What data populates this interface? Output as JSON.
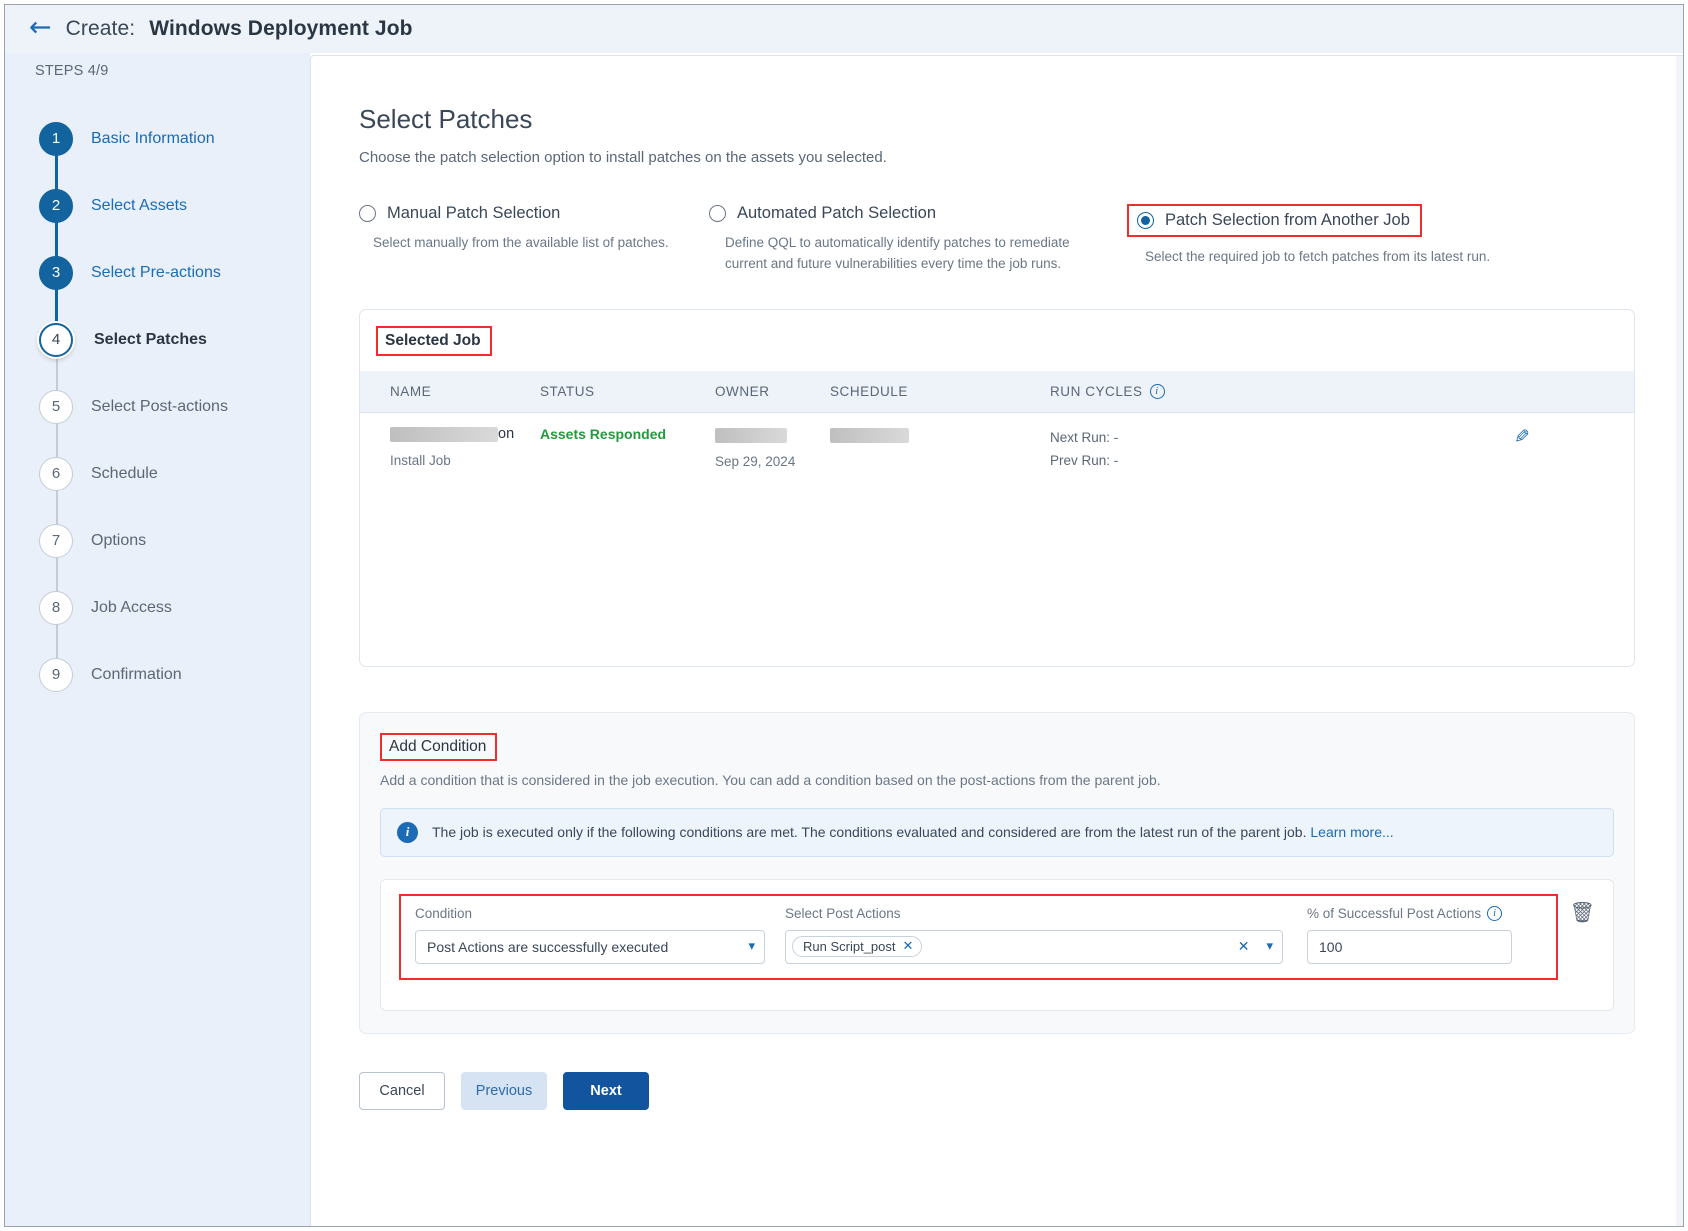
{
  "header": {
    "back_icon": "back-arrow-icon",
    "create_label": "Create:",
    "title": "Windows Deployment Job"
  },
  "sidebar": {
    "steps_label": "STEPS 4/9",
    "items": [
      {
        "num": "1",
        "label": "Basic Information",
        "state": "done"
      },
      {
        "num": "2",
        "label": "Select Assets",
        "state": "done"
      },
      {
        "num": "3",
        "label": "Select Pre-actions",
        "state": "done"
      },
      {
        "num": "4",
        "label": "Select Patches",
        "state": "current"
      },
      {
        "num": "5",
        "label": "Select Post-actions",
        "state": "todo"
      },
      {
        "num": "6",
        "label": "Schedule",
        "state": "todo"
      },
      {
        "num": "7",
        "label": "Options",
        "state": "todo"
      },
      {
        "num": "8",
        "label": "Job Access",
        "state": "todo"
      },
      {
        "num": "9",
        "label": "Confirmation",
        "state": "todo"
      }
    ]
  },
  "main": {
    "title": "Select Patches",
    "subtitle": "Choose the patch selection option to install patches on the assets you selected.",
    "options": [
      {
        "title": "Manual Patch Selection",
        "desc": "Select manually from the available list of patches.",
        "selected": false
      },
      {
        "title": "Automated Patch Selection",
        "desc": "Define QQL to automatically identify patches to remediate current and future vulnerabilities every time the job runs.",
        "selected": false
      },
      {
        "title": "Patch Selection from Another Job",
        "desc": "Select the required job to fetch patches from its latest run.",
        "selected": true
      }
    ],
    "selected_job": {
      "card_title": "Selected Job",
      "columns": [
        "NAME",
        "STATUS",
        "OWNER",
        "SCHEDULE",
        "RUN CYCLES"
      ],
      "run_cycles_info_icon": "info-icon",
      "rows": [
        {
          "name_redacted": true,
          "name_suffix": "on",
          "name_sub": "Install Job",
          "status": "Assets Responded",
          "owner_redacted": true,
          "owner_sub": "Sep 29, 2024",
          "schedule_redacted": true,
          "next_run": "Next Run: -",
          "prev_run": "Prev Run: -",
          "edit_icon": "pencil-icon"
        }
      ]
    },
    "add_condition": {
      "title": "Add Condition",
      "subtitle": "Add a condition that is considered in the job execution. You can add a condition based on the post-actions from the parent job.",
      "info_banner": {
        "icon": "info-icon",
        "text": "The job is executed only if the following conditions are met. The conditions evaluated and considered are from the latest run of the parent job.",
        "link": "Learn more..."
      },
      "row": {
        "condition_label": "Condition",
        "condition_value": "Post Actions are successfully executed",
        "post_actions_label": "Select Post Actions",
        "post_actions_chips": [
          "Run Script_post"
        ],
        "percent_label": "% of Successful Post Actions",
        "percent_info_icon": "info-icon",
        "percent_value": "100",
        "delete_icon": "trash-icon"
      }
    },
    "footer": {
      "cancel": "Cancel",
      "previous": "Previous",
      "next": "Next"
    }
  },
  "colors": {
    "accent": "#12639e",
    "primary_button": "#12549e",
    "highlight_outline": "#ef2d2d",
    "status_success": "#249a3c",
    "link": "#1b6bb5"
  }
}
